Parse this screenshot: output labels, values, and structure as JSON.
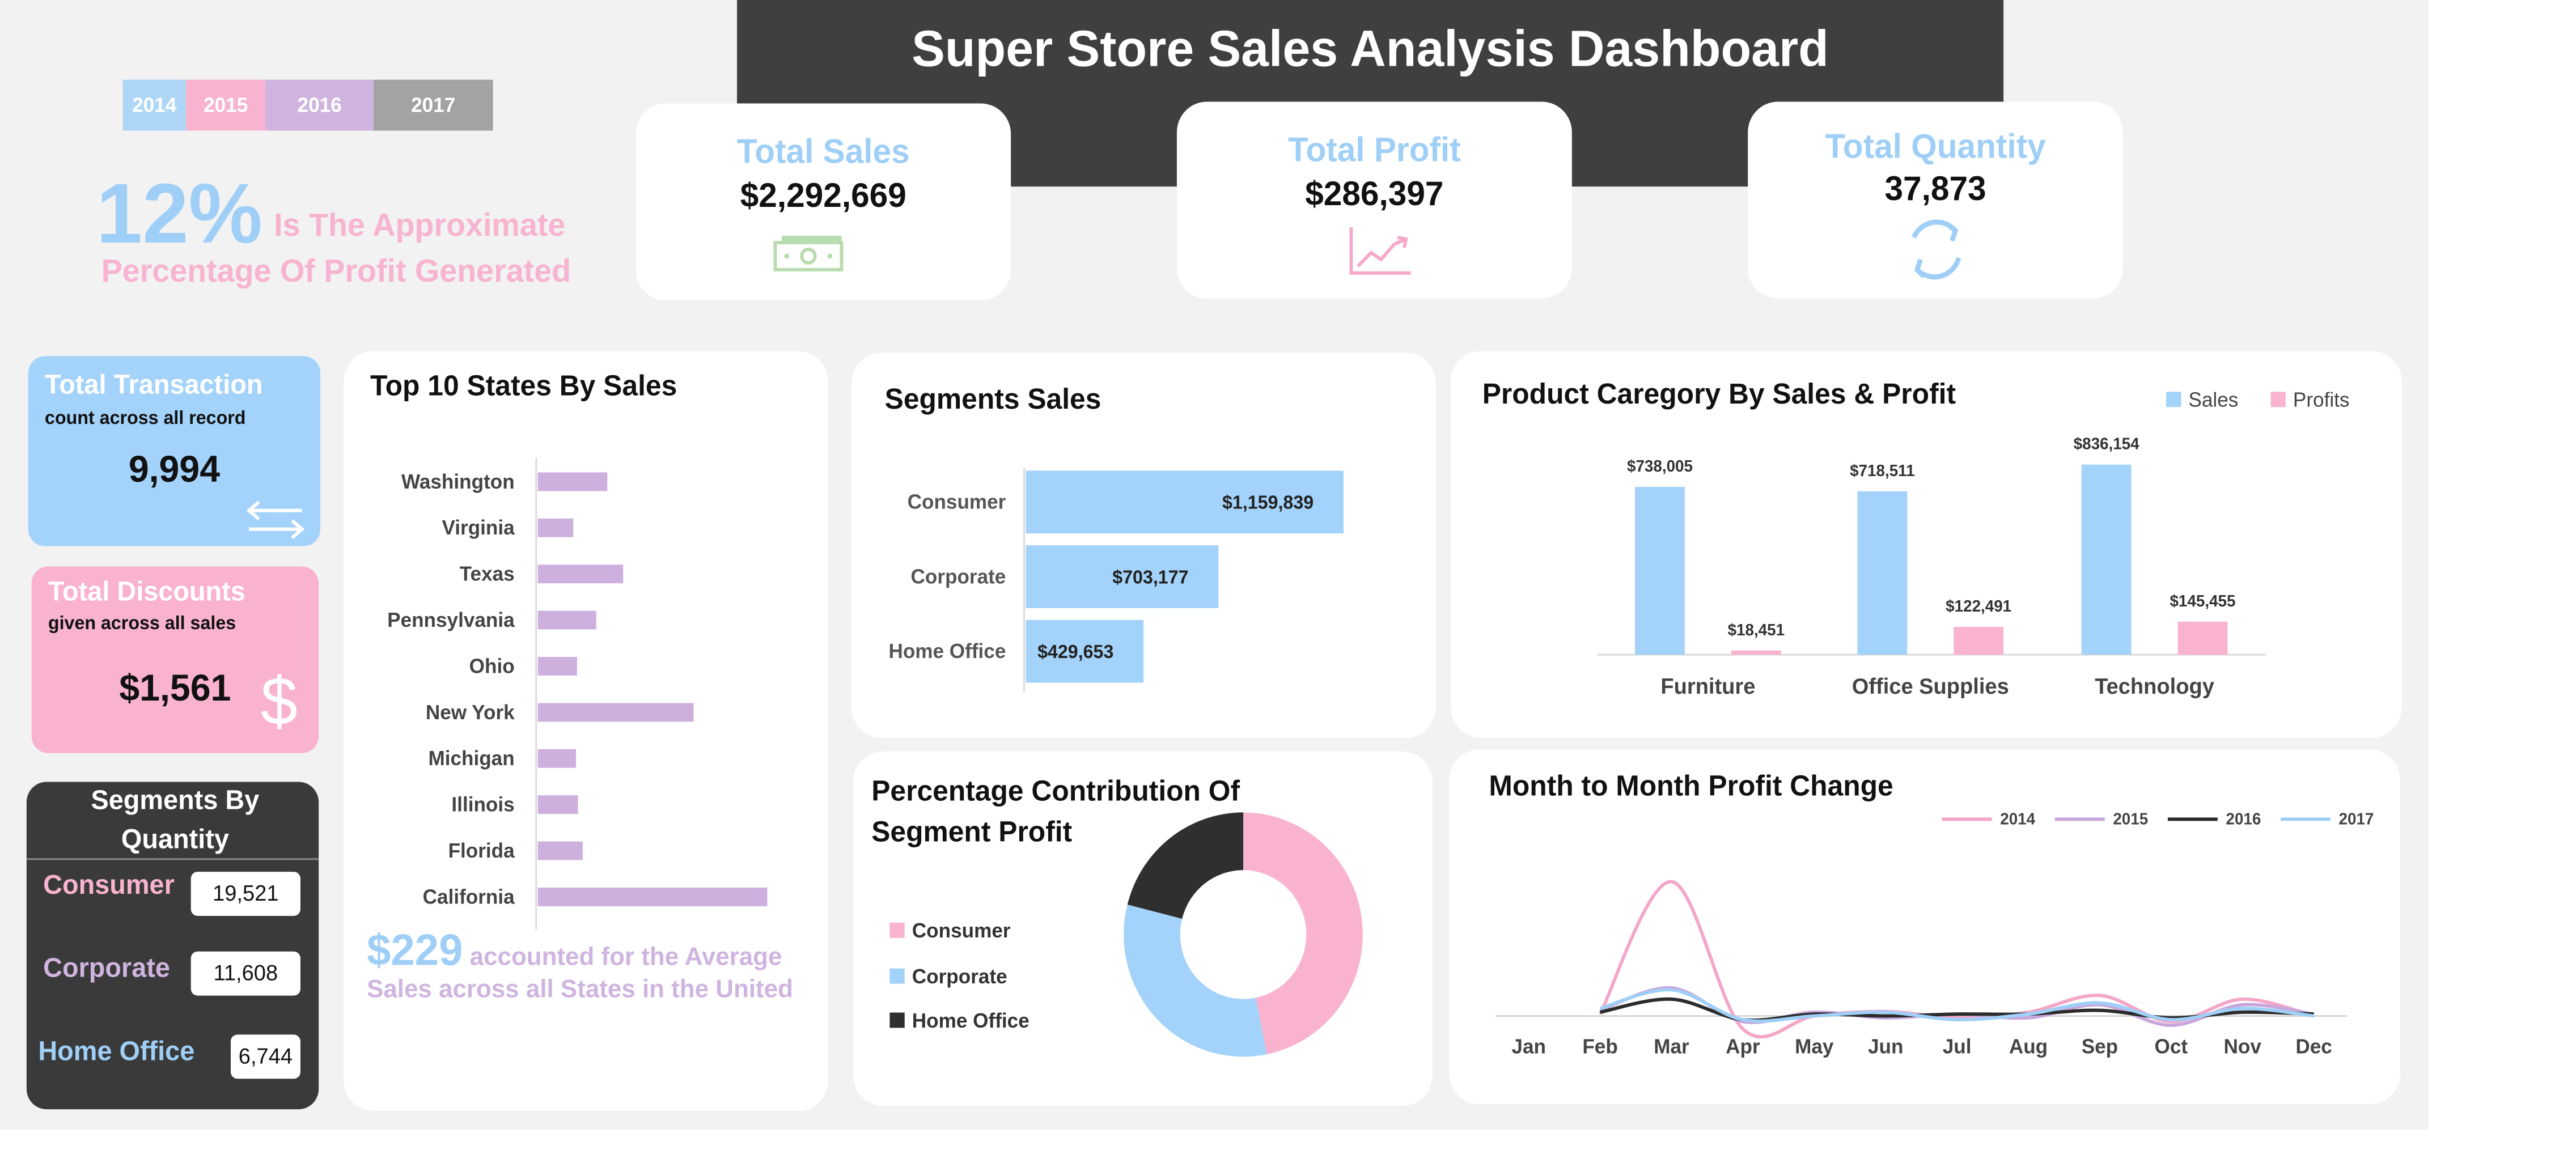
{
  "dashboard": {
    "title": "Super Store Sales Analysis Dashboard"
  },
  "years": [
    {
      "label": "2014",
      "color": "#aed6f7"
    },
    {
      "label": "2015",
      "color": "#f7b3cf"
    },
    {
      "label": "2016",
      "color": "#cfb4df"
    },
    {
      "label": "2017",
      "color": "#a3a3a3"
    }
  ],
  "profit_note": {
    "pct": "12%",
    "line1": "Is The Approximate",
    "line2": "Percentage Of Profit Generated"
  },
  "kpis": {
    "total_sales": {
      "label": "Total Sales",
      "value": "$2,292,669",
      "icon": "money-icon"
    },
    "total_profit": {
      "label": "Total Profit",
      "value": "$286,397",
      "icon": "growth-chart-icon"
    },
    "total_quantity": {
      "label": "Total Quantity",
      "value": "37,873",
      "icon": "refresh-cycle-icon"
    }
  },
  "transactions": {
    "title": "Total Transaction",
    "subtitle": "count across all record",
    "value": "9,994",
    "icon": "exchange-arrows-icon"
  },
  "discounts": {
    "title": "Total Discounts",
    "subtitle": "given across all sales",
    "value": "$1,561",
    "icon": "dollar-icon"
  },
  "segments_quantity": {
    "title": "Segments By Quantity",
    "items": [
      {
        "name": "Consumer",
        "value": "19,521",
        "color": "#f7b3cf"
      },
      {
        "name": "Corporate",
        "value": "11,608",
        "color": "#cfb4df"
      },
      {
        "name": "Home Office",
        "value": "6,744",
        "color": "#9fcff7"
      }
    ]
  },
  "states_note": {
    "value": "$229",
    "text": "accounted for the Average Sales across all States in the United"
  },
  "colors": {
    "blue": "#a3d2fa",
    "pink": "#f9b3cf",
    "purple": "#cdb0de",
    "dark": "#2f2f2f",
    "bg": "#f2f2f2"
  },
  "chart_data": [
    {
      "id": "top_states",
      "type": "bar",
      "orientation": "horizontal",
      "title": "Top 10 States By Sales",
      "categories": [
        "Washington",
        "Virginia",
        "Texas",
        "Pennsylvania",
        "Ohio",
        "New York",
        "Michigan",
        "Illinois",
        "Florida",
        "California"
      ],
      "values": [
        138641,
        70637,
        170188,
        116512,
        78258,
        310876,
        76270,
        80166,
        89474,
        457688
      ],
      "xlim": [
        0,
        480000
      ]
    },
    {
      "id": "segment_sales",
      "type": "bar",
      "orientation": "horizontal",
      "title": "Segments Sales",
      "categories": [
        "Consumer",
        "Corporate",
        "Home Office"
      ],
      "values": [
        1159839,
        703177,
        429653
      ],
      "data_labels": [
        "$1,159,839",
        "$703,177",
        "$429,653"
      ],
      "xlim": [
        0,
        1200000
      ]
    },
    {
      "id": "category_sales_profit",
      "type": "bar",
      "title": "Product Caregory By Sales & Profit",
      "categories": [
        "Furniture",
        "Office Supplies",
        "Technology"
      ],
      "series": [
        {
          "name": "Sales",
          "values": [
            738005,
            718511,
            836154
          ],
          "labels": [
            "$738,005",
            "$718,511",
            "$836,154"
          ],
          "color": "#a3d2fa"
        },
        {
          "name": "Profits",
          "values": [
            18451,
            122491,
            145455
          ],
          "labels": [
            "$18,451",
            "$122,491",
            "$145,455"
          ],
          "color": "#f9b3cf"
        }
      ],
      "ylim": [
        0,
        900000
      ],
      "legend": "top-right"
    },
    {
      "id": "segment_profit_share",
      "type": "pie",
      "donut": true,
      "title": "Percentage Contribution Of Segment Profit",
      "labels": [
        "Consumer",
        "Corporate",
        "Home Office"
      ],
      "values": [
        134119,
        91979,
        60299
      ],
      "colors": [
        "#f9b3cf",
        "#a3d2fa",
        "#2f2f2f"
      ],
      "legend": "left"
    },
    {
      "id": "monthly_profit_change",
      "type": "line",
      "title": "Month to Month Profit Change",
      "categories": [
        "Jan",
        "Feb",
        "Mar",
        "Apr",
        "May",
        "Jun",
        "Jul",
        "Aug",
        "Sep",
        "Oct",
        "Nov",
        "Dec"
      ],
      "series": [
        {
          "name": "2014",
          "color": "#f4a6c7",
          "values": [
            null,
            0.05,
            3.6,
            -0.35,
            0.0,
            0.12,
            -0.05,
            0.1,
            0.55,
            -0.15,
            0.45,
            0.0
          ]
        },
        {
          "name": "2015",
          "color": "#c9a7dc",
          "values": [
            null,
            0.15,
            0.75,
            -0.15,
            0.1,
            -0.05,
            0.05,
            -0.05,
            0.3,
            -0.25,
            0.3,
            0.05
          ]
        },
        {
          "name": "2016",
          "color": "#2b2b2b",
          "values": [
            null,
            0.1,
            0.45,
            -0.1,
            0.05,
            0.0,
            0.05,
            0.05,
            0.15,
            -0.05,
            0.1,
            0.05
          ]
        },
        {
          "name": "2017",
          "color": "#9fcff7",
          "values": [
            null,
            0.2,
            0.7,
            -0.1,
            0.0,
            0.1,
            -0.1,
            0.05,
            0.35,
            -0.1,
            0.2,
            0.0
          ]
        }
      ],
      "ylim": [
        -0.6,
        4.2
      ],
      "legend": "top-right"
    }
  ]
}
